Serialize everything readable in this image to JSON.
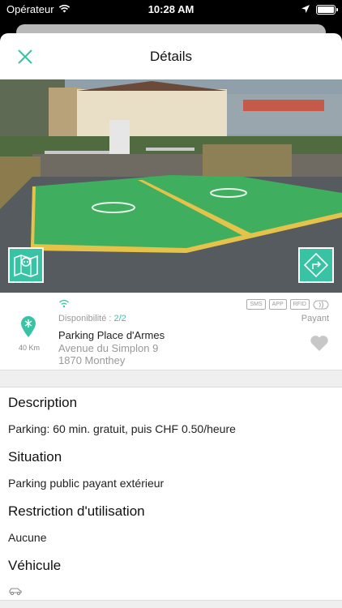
{
  "status_bar": {
    "carrier": "Opérateur",
    "time": "10:28 AM",
    "icons": [
      "wifi-icon",
      "location-arrow-icon",
      "battery-icon"
    ]
  },
  "header": {
    "title": "Détails",
    "close_icon": "close-icon"
  },
  "photo": {
    "map_button_icon": "map-plug-icon",
    "route_button_icon": "directions-icon"
  },
  "station": {
    "availability_label": "Disponibilité :",
    "availability_value": "2/2",
    "name": "Parking Place d'Armes",
    "address_line1": "Avenue du Simplon 9",
    "address_line2": "1870 Monthey",
    "distance": "40 Km",
    "access_badges": [
      "SMS",
      "APP",
      "RFID"
    ],
    "pricing": "Payant"
  },
  "sections": {
    "description_title": "Description",
    "description_text": "Parking: 60 min. gratuit, puis CHF 0.50/heure",
    "situation_title": "Situation",
    "situation_text": "Parking public payant extérieur",
    "restriction_title": "Restriction d'utilisation",
    "restriction_text": "Aucune",
    "vehicle_title": "Véhicule",
    "vehicle_icon": "car-icon"
  },
  "colors": {
    "accent": "#38c3a4",
    "text": "#222222",
    "muted": "#999999"
  }
}
